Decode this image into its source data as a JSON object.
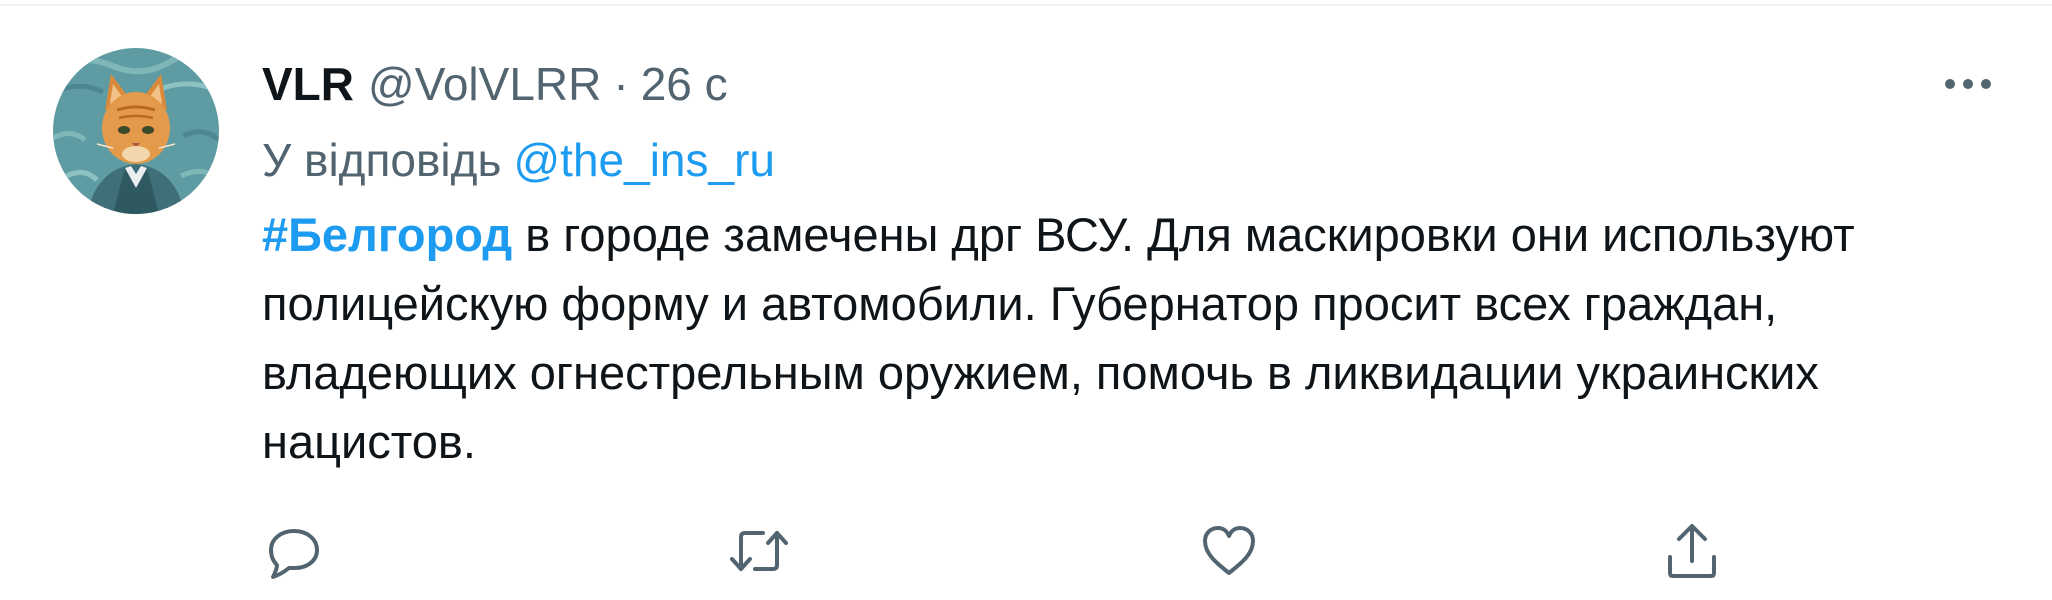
{
  "tweet": {
    "author": {
      "display_name": "VLR",
      "handle": "@VolVLRR",
      "avatar_icon": "cat-portrait-avatar"
    },
    "separator": "·",
    "time": "26 с",
    "reply_prefix": "У відповідь",
    "reply_to": "@the_ins_ru",
    "hashtag": "#Белгород",
    "body": " в городе замечены дрг ВСУ. Для маскировки они используют полицейскую форму и автомобили. Губернатор просит всех граждан, владеющих огнестрельным оружием, помочь в ликвидации украинских нацистов.",
    "more_icon": "more-horizontal-icon",
    "actions": [
      {
        "name": "reply",
        "icon": "reply-bubble-icon"
      },
      {
        "name": "retweet",
        "icon": "retweet-icon"
      },
      {
        "name": "like",
        "icon": "heart-icon"
      },
      {
        "name": "share",
        "icon": "share-icon"
      }
    ]
  },
  "colors": {
    "primary_text": "#0f1419",
    "secondary_text": "#536471",
    "link": "#1d9bf0",
    "divider": "#eff3f4"
  }
}
